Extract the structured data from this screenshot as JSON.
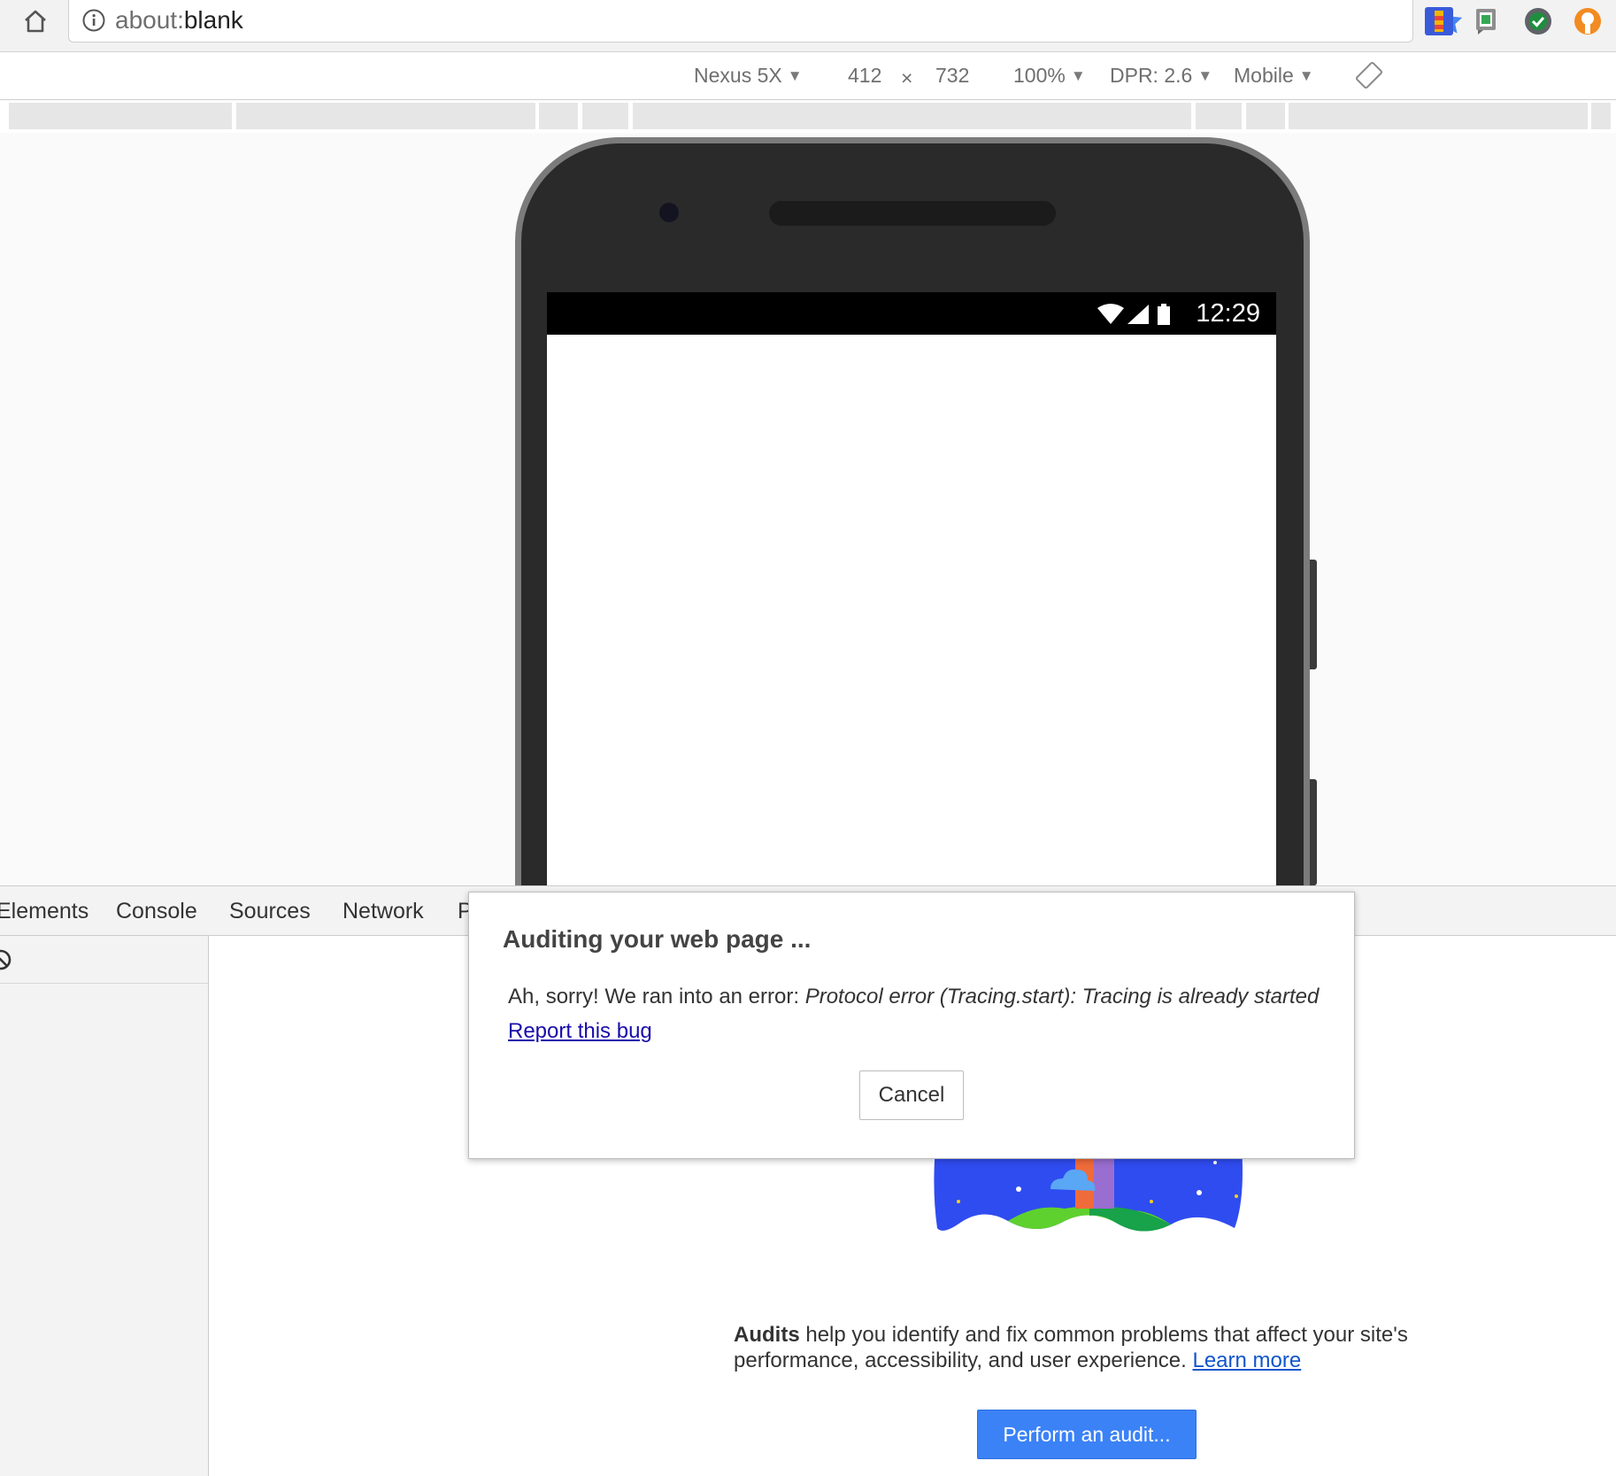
{
  "browser": {
    "url_scheme": "about:",
    "url_rest": "blank",
    "star_color": "#4285f4",
    "extensions": [
      "lighthouse-ext-icon",
      "translate-ext-icon",
      "check-ext-icon",
      "security-ext-icon"
    ]
  },
  "device_bar": {
    "device": "Nexus 5X",
    "width": "412",
    "times": "×",
    "height": "732",
    "zoom": "100%",
    "dpr": "DPR: 2.6",
    "mode": "Mobile",
    "caret": "▼"
  },
  "phone": {
    "clock": "12:29"
  },
  "devtools": {
    "tabs": [
      "Elements",
      "Console",
      "Sources",
      "Network",
      "P"
    ],
    "audits_bold": "Audits",
    "audits_text": " help you identify and fix common problems that affect your site's performance, accessibility, and user experience. ",
    "learn_more": "Learn more",
    "perform_button": "Perform an audit...",
    "accent": "#3b82f6"
  },
  "dialog": {
    "title": "Auditing your web page ...",
    "msg_plain": "Ah, sorry! We ran into an error: ",
    "msg_italic": "Protocol error (Tracing.start): Tracing is already started",
    "report_link": "Report this bug",
    "cancel": "Cancel"
  }
}
